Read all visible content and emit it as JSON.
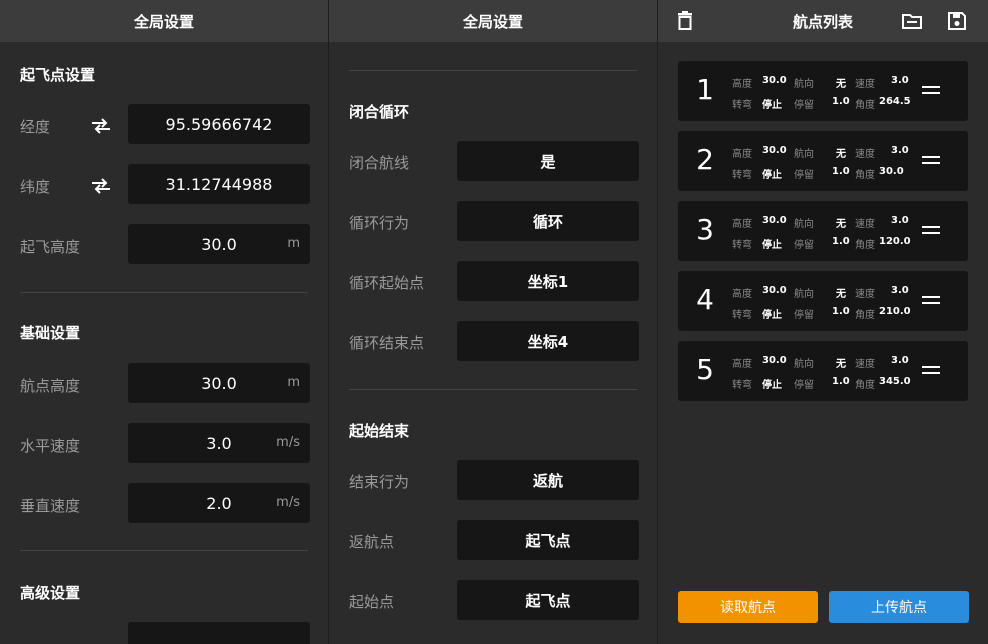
{
  "panel_left": {
    "title": "全局设置",
    "takeoff": {
      "section": "起飞点设置",
      "longitude_label": "经度",
      "longitude_value": "95.59666742",
      "latitude_label": "纬度",
      "latitude_value": "31.12744988",
      "altitude_label": "起飞高度",
      "altitude_value": "30.0",
      "altitude_unit": "m"
    },
    "basic": {
      "section": "基础设置",
      "wp_alt_label": "航点高度",
      "wp_alt_value": "30.0",
      "wp_alt_unit": "m",
      "h_speed_label": "水平速度",
      "h_speed_value": "3.0",
      "h_speed_unit": "m/s",
      "v_speed_label": "垂直速度",
      "v_speed_value": "2.0",
      "v_speed_unit": "m/s"
    },
    "advanced": {
      "section": "高级设置"
    }
  },
  "panel_middle": {
    "title": "全局设置",
    "loop": {
      "section": "闭合循环",
      "closed_label": "闭合航线",
      "closed_value": "是",
      "behavior_label": "循环行为",
      "behavior_value": "循环",
      "start_label": "循环起始点",
      "start_value": "坐标1",
      "end_label": "循环结束点",
      "end_value": "坐标4"
    },
    "startend": {
      "section": "起始结束",
      "end_behavior_label": "结束行为",
      "end_behavior_value": "返航",
      "return_label": "返航点",
      "return_value": "起飞点",
      "start_label": "起始点",
      "start_value": "起飞点"
    }
  },
  "panel_right": {
    "title": "航点列表",
    "labels": {
      "height": "高度",
      "heading": "航向",
      "speed": "速度",
      "turn": "转弯",
      "hover": "停留",
      "angle": "角度"
    },
    "waypoints": [
      {
        "num": "1",
        "height": "30.0",
        "heading": "无",
        "speed": "3.0",
        "turn": "停止",
        "hover": "1.0",
        "angle": "264.5"
      },
      {
        "num": "2",
        "height": "30.0",
        "heading": "无",
        "speed": "3.0",
        "turn": "停止",
        "hover": "1.0",
        "angle": "30.0"
      },
      {
        "num": "3",
        "height": "30.0",
        "heading": "无",
        "speed": "3.0",
        "turn": "停止",
        "hover": "1.0",
        "angle": "120.0"
      },
      {
        "num": "4",
        "height": "30.0",
        "heading": "无",
        "speed": "3.0",
        "turn": "停止",
        "hover": "1.0",
        "angle": "210.0"
      },
      {
        "num": "5",
        "height": "30.0",
        "heading": "无",
        "speed": "3.0",
        "turn": "停止",
        "hover": "1.0",
        "angle": "345.0"
      }
    ],
    "read_button": "读取航点",
    "upload_button": "上传航点"
  },
  "colors": {
    "accent_orange": "#f39200",
    "accent_blue": "#2a8cdc",
    "panel_bg": "#2b2b2b",
    "field_bg": "#161616"
  },
  "icons": [
    "swap-icon",
    "trash-icon",
    "folder-icon",
    "save-icon",
    "drag-handle-icon"
  ]
}
